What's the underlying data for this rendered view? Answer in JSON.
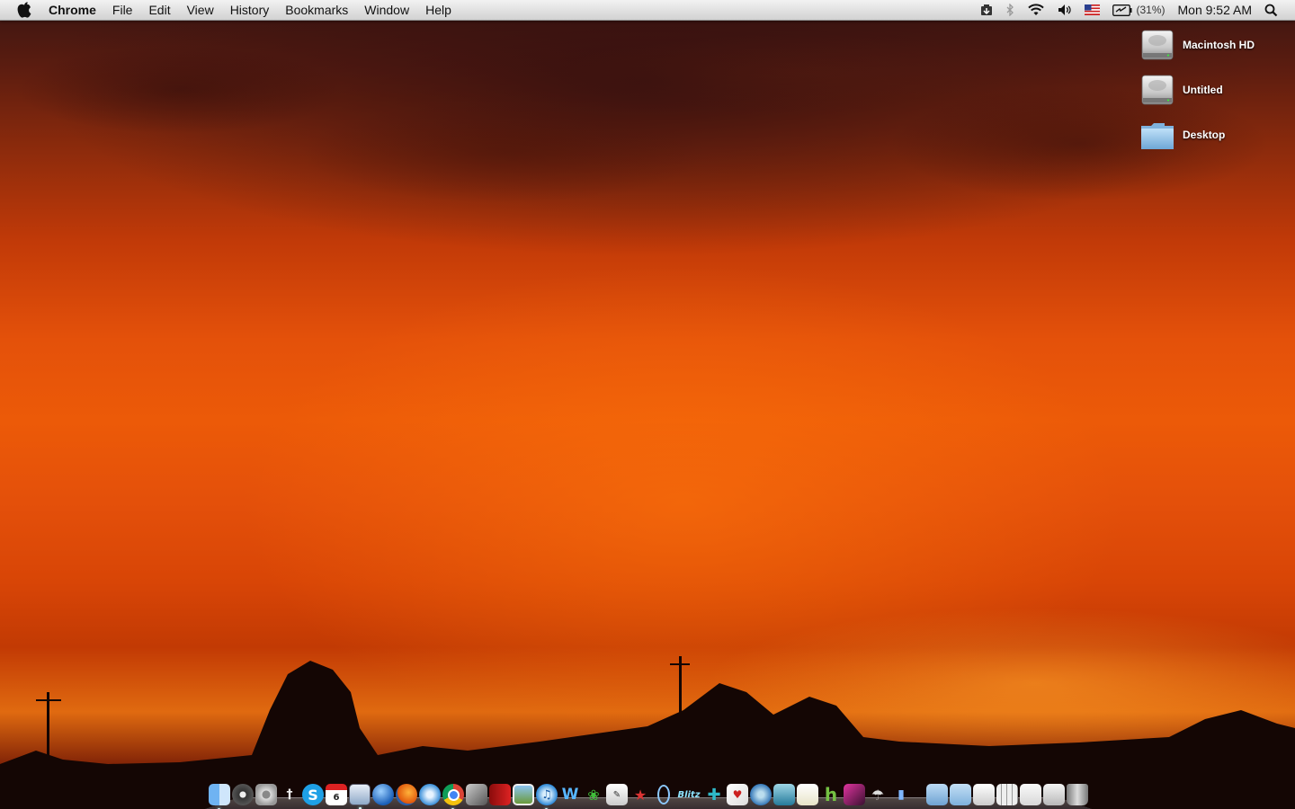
{
  "menubar": {
    "app_name": "Chrome",
    "menus": [
      "File",
      "Edit",
      "View",
      "History",
      "Bookmarks",
      "Window",
      "Help"
    ],
    "battery_percent_label": "(31%)",
    "clock": "Mon 9:52 AM"
  },
  "desktop_icons": [
    {
      "label": "Macintosh HD",
      "icon": "hard-drive-icon"
    },
    {
      "label": "Untitled",
      "icon": "hard-drive-icon"
    },
    {
      "label": "Desktop",
      "icon": "folder-icon"
    }
  ],
  "dock": {
    "calendar_day": "6",
    "blitz_label": "Blitz"
  },
  "colors": {
    "sky_orange": "#ec5a08",
    "sky_dark": "#3a1512",
    "menubar": "#e2e2e2"
  }
}
